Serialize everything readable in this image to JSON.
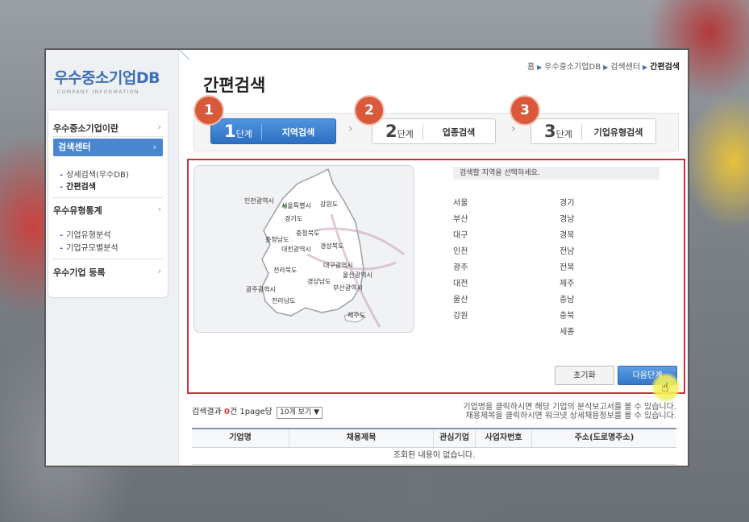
{
  "sidebar": {
    "logo": "우수중소기업DB",
    "logo_sub": "COMPANY INFORMATION",
    "menu": [
      {
        "label": "우수중소기업이란"
      },
      {
        "label": "검색센터"
      },
      {
        "label": "우수유형통계"
      },
      {
        "label": "우수기업 등록"
      }
    ],
    "search_sub": [
      "상세검색(우수DB)",
      "간편검색"
    ],
    "stats_sub": [
      "기업유형분석",
      "기업규모별분석"
    ]
  },
  "breadcrumb": {
    "home": "홈",
    "db": "우수중소기업DB",
    "center": "검색센터",
    "current": "간편검색"
  },
  "page_title": "간편검색",
  "steps": [
    {
      "badge": "1",
      "num": "1",
      "unit": "단계",
      "label": "지역검색"
    },
    {
      "badge": "2",
      "num": "2",
      "unit": "단계",
      "label": "업종검색"
    },
    {
      "badge": "3",
      "num": "3",
      "unit": "단계",
      "label": "기업유형검색"
    }
  ],
  "map_labels": [
    "인천광역시",
    "서울특별시",
    "강원도",
    "경기도",
    "충청북도",
    "충청남도",
    "경상북도",
    "대전광역시",
    "대구광역시",
    "전라북도",
    "울산광역시",
    "경상남도",
    "광주광역시",
    "부산광역시",
    "전라남도",
    "제주도"
  ],
  "instruction": "검색할 지역을 선택하세요.",
  "regions_left": [
    "서울",
    "부산",
    "대구",
    "인천",
    "광주",
    "대전",
    "울산",
    "강원"
  ],
  "regions_right": [
    "경기",
    "경남",
    "경북",
    "전남",
    "전북",
    "제주",
    "충남",
    "충북",
    "세종"
  ],
  "buttons": {
    "reset": "초기화",
    "next": "다음단계"
  },
  "result": {
    "prefix": "검색결과",
    "count": "0",
    "suffix": "건 1page당",
    "per_page": "10개 보기 ▼"
  },
  "notice": [
    "기업명을 클릭하시면 해당 기업의 분석보고서를 볼 수 있습니다.",
    "채용제목을 클릭하시면 워크넷 상세채용정보를 볼 수 있습니다."
  ],
  "table": {
    "headers": [
      "기업명",
      "채용제목",
      "관심기업",
      "사업자번호",
      "주소(도로명주소)"
    ],
    "empty": "조회된 내용이 없습니다."
  }
}
